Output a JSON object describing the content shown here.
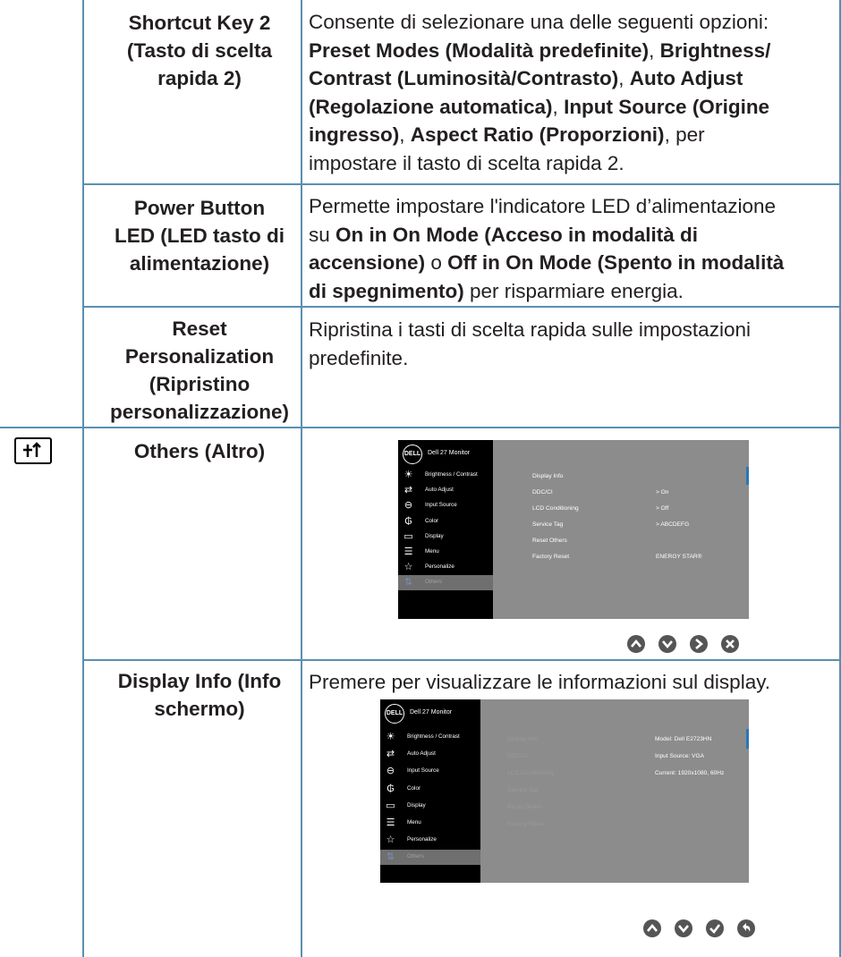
{
  "rows": [
    {
      "name": "Shortcut Key 2 (Tasto di scelta rapida 2)",
      "name_lines": [
        "Shortcut Key 2",
        "(Tasto di scelta",
        "rapida 2)"
      ],
      "desc_lines": [
        [
          {
            "t": "Consente di selezionare una delle seguenti opzioni:",
            "b": false
          }
        ],
        [
          {
            "t": "Preset Modes (Modalità predefinite)",
            "b": true
          },
          {
            "t": ", ",
            "b": false
          },
          {
            "t": "Brightness/",
            "b": true
          }
        ],
        [
          {
            "t": "Contrast (Luminosità/Contrasto)",
            "b": true
          },
          {
            "t": ", ",
            "b": false
          },
          {
            "t": "Auto Adjust",
            "b": true
          }
        ],
        [
          {
            "t": "(Regolazione automatica)",
            "b": true
          },
          {
            "t": ", ",
            "b": false
          },
          {
            "t": "Input Source (Origine",
            "b": true
          }
        ],
        [
          {
            "t": "ingresso)",
            "b": true
          },
          {
            "t": ", ",
            "b": false
          },
          {
            "t": "Aspect Ratio (Proporzioni)",
            "b": true
          },
          {
            "t": ", per",
            "b": false
          }
        ],
        [
          {
            "t": "impostare il tasto di scelta rapida 2.",
            "b": false
          }
        ]
      ]
    },
    {
      "name_lines": [
        "Power Button",
        "LED (LED tasto di",
        "alimentazione)"
      ],
      "desc_lines": [
        [
          {
            "t": "Permette impostare l'indicatore LED d’alimentazione",
            "b": false
          }
        ],
        [
          {
            "t": "su ",
            "b": false
          },
          {
            "t": "On in On Mode (Acceso in modalità di",
            "b": true
          }
        ],
        [
          {
            "t": "accensione)",
            "b": true
          },
          {
            "t": " o ",
            "b": false
          },
          {
            "t": "Off in On Mode (Spento in modalità",
            "b": true
          }
        ],
        [
          {
            "t": "di spegnimento)",
            "b": true
          },
          {
            "t": " per risparmiare energia.",
            "b": false
          }
        ]
      ]
    },
    {
      "name_lines": [
        "Reset",
        "Personalization",
        "(Ripristino",
        "personalizzazione)"
      ],
      "desc_lines": [
        [
          {
            "t": "Ripristina i tasti di scelta rapida sulle impostazioni",
            "b": false
          }
        ],
        [
          {
            "t": "predefinite.",
            "b": false
          }
        ]
      ]
    },
    {
      "name_lines": [
        "Others (Altro)"
      ],
      "icon": "others-sliders-icon"
    },
    {
      "name_lines": [
        "Display Info (Info",
        "schermo)"
      ],
      "desc_lines": [
        [
          {
            "t": "Premere per visualizzare le informazioni sul display.",
            "b": false
          }
        ]
      ]
    }
  ],
  "osd": {
    "logo": "DELL",
    "title": "Dell 27 Monitor",
    "menu": [
      {
        "label": "Brightness / Contrast",
        "icon": "sun-icon"
      },
      {
        "label": "Auto Adjust",
        "icon": "arrows-icon"
      },
      {
        "label": "Input Source",
        "icon": "input-icon"
      },
      {
        "label": "Color",
        "icon": "color-icon"
      },
      {
        "label": "Display",
        "icon": "monitor-icon"
      },
      {
        "label": "Menu",
        "icon": "menu-icon"
      },
      {
        "label": "Personalize",
        "icon": "star-icon"
      },
      {
        "label": "Others",
        "icon": "others-icon"
      }
    ],
    "others_sub": [
      "Display Info",
      "DDC/CI",
      "LCD Conditioning",
      "Service Tag",
      "Reset Others",
      "Factory Reset"
    ],
    "others_vals": [
      "> On",
      "> Off",
      "> ABCDEFG",
      "ENERGY STAR®"
    ],
    "info_vals": [
      "Model: Dell E2723HN",
      "Input Source: VGA",
      "Current: 1920x1080, 60Hz"
    ]
  }
}
